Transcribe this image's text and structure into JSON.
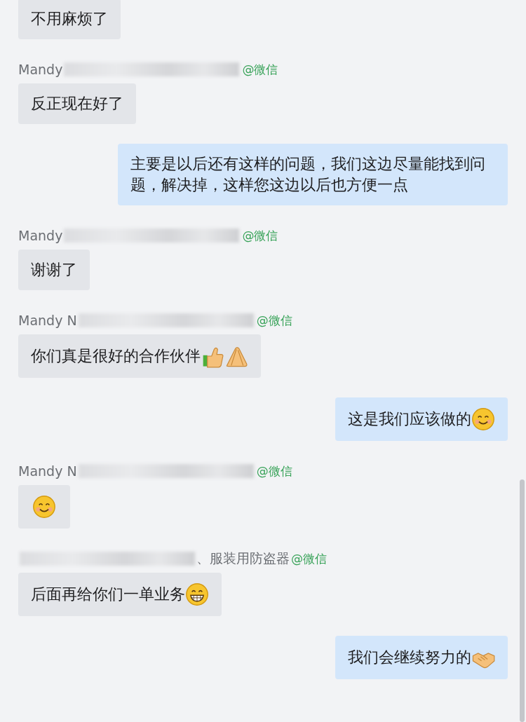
{
  "messages": [
    {
      "kind": "incoming",
      "text": "不用麻烦了"
    },
    {
      "kind": "incoming",
      "sender": {
        "name": "Mandy",
        "redacted": true,
        "channel": "@微信"
      },
      "text": "反正现在好了"
    },
    {
      "kind": "outgoing",
      "text": "主要是以后还有这样的问题，我们这边尽量能找到问题，解决掉，这样您这边以后也方便一点"
    },
    {
      "kind": "incoming",
      "sender": {
        "name": "Mandy",
        "redacted": true,
        "channel": "@微信"
      },
      "text": "谢谢了"
    },
    {
      "kind": "incoming",
      "sender": {
        "name": "Mandy N",
        "redacted": true,
        "channel": "@微信"
      },
      "text": "你们真是很好的合作伙伴",
      "emoji": [
        {
          "kind": "thumbs-up"
        },
        {
          "kind": "hands"
        }
      ]
    },
    {
      "kind": "outgoing",
      "text": "这是我们应该做的",
      "emoji": [
        {
          "kind": "smile"
        }
      ]
    },
    {
      "kind": "incoming",
      "sender": {
        "name": "Mandy N",
        "redacted": true,
        "channel": "@微信"
      },
      "emoji": [
        {
          "kind": "smile"
        }
      ]
    },
    {
      "kind": "incoming",
      "sender": {
        "redacted": true,
        "name_tail": "、服装用防盗器",
        "channel": "@微信"
      },
      "text": "后面再给你们一单业务",
      "emoji": [
        {
          "kind": "grin"
        }
      ]
    },
    {
      "kind": "outgoing",
      "text": "我们会继续努力的",
      "emoji": [
        {
          "kind": "handshake"
        }
      ]
    }
  ]
}
